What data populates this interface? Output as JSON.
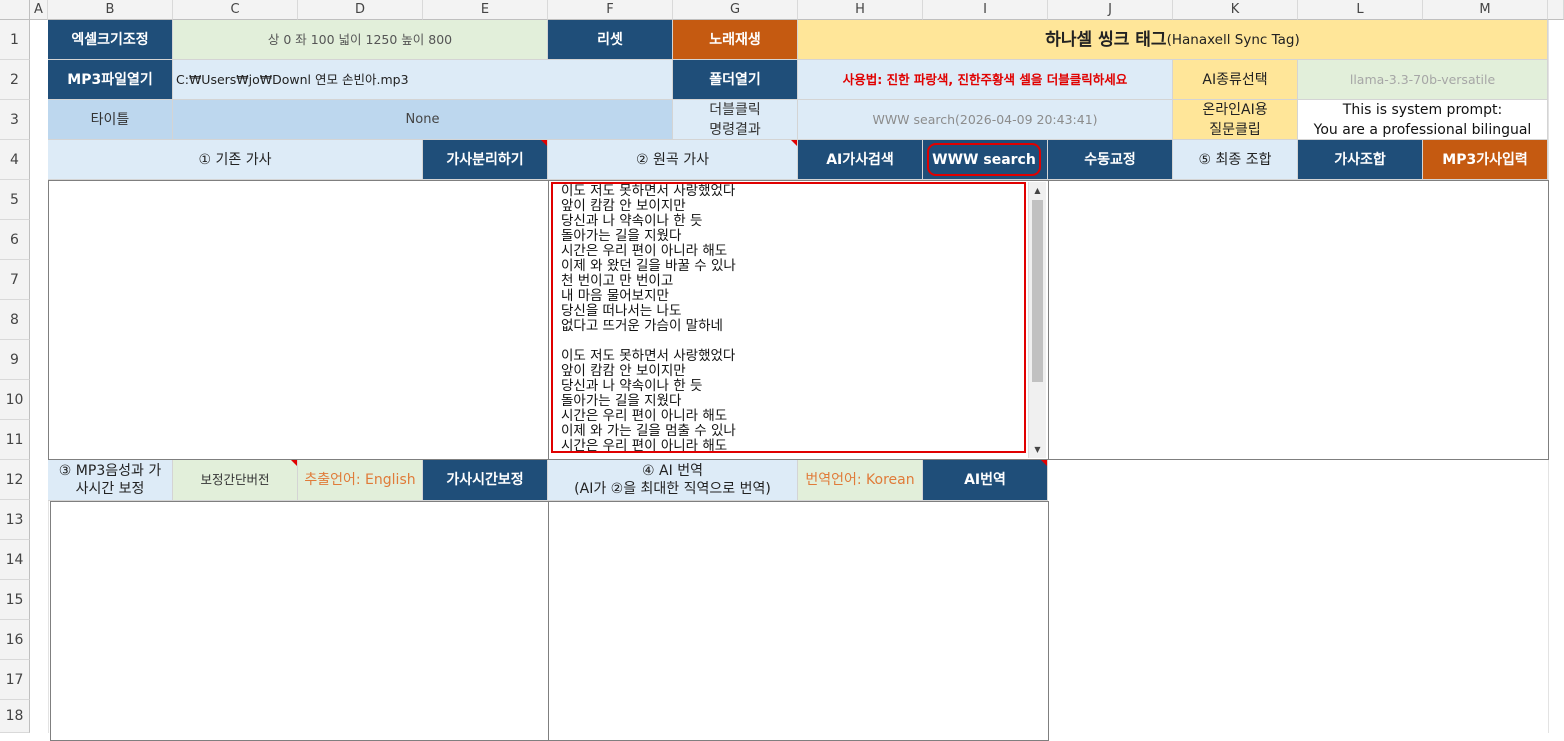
{
  "columns": [
    "A",
    "B",
    "C",
    "D",
    "E",
    "F",
    "G",
    "H",
    "I",
    "J",
    "K",
    "L",
    "M"
  ],
  "rows": [
    "1",
    "2",
    "3",
    "4",
    "5",
    "6",
    "7",
    "8",
    "9",
    "10",
    "11",
    "12",
    "13",
    "14",
    "15",
    "16",
    "17",
    "18"
  ],
  "row1": {
    "resize_button": "엑셀크기조정",
    "resize_values": "상 0 좌 100 넓이 1250 높이 800",
    "reset_button": "리셋",
    "play_button": "노래재생",
    "app_title": "하나셀 씽크 태그",
    "app_title_en": "(Hanaxell Sync Tag)"
  },
  "row2": {
    "open_mp3_button": "MP3파일열기",
    "file_path": "C:₩Users₩jo₩Downl 연모 손빈아.mp3",
    "open_folder_button": "폴더열기",
    "usage_hint": "사용법: 진한 파랑색, 진한주황색 셀을 더블클릭하세요",
    "ai_type_button": "AI종류선택",
    "ai_model": "llama-3.3-70b-versatile"
  },
  "row3": {
    "title_label": "타이틀",
    "title_value": "None",
    "dblclick_label_1": "더블클릭",
    "dblclick_label_2": "명령결과",
    "command_result": "WWW search(2026-04-09 20:43:41)",
    "online_ai_1": "온라인AI용",
    "online_ai_2": "질문클립",
    "system_prompt_1": "This is system prompt:",
    "system_prompt_2": "You are a professional bilingual"
  },
  "row4": {
    "existing_lyrics": "① 기존 가사",
    "split_lyrics_button": "가사분리하기",
    "original_lyrics": "② 원곡 가사",
    "ai_lyrics_search_button": "AI가사검색",
    "www_search_button": "WWW search",
    "manual_edit_button": "수동교정",
    "final_combine": "⑤ 최종 조합",
    "combine_lyrics_button": "가사조합",
    "mp3_lyrics_input_button": "MP3가사입력"
  },
  "lyrics": {
    "text": "이도 저도 못하면서 사랑했었다\n앞이 캄캄 안 보이지만\n당신과 나 약속이나 한 듯\n돌아가는 길을 지웠다\n시간은 우리 편이 아니라 해도\n이제 와 왔던 길을 바꿀 수 있나\n천 번이고 만 번이고\n내 마음 물어보지만\n당신을 떠나서는 나도\n없다고 뜨거운 가슴이 말하네\n\n이도 저도 못하면서 사랑했었다\n앞이 캄캄 안 보이지만\n당신과 나 약속이나 한 듯\n돌아가는 길을 지웠다\n시간은 우리 편이 아니라 해도\n이제 와 가는 길을 멈출 수 있나\n시간은 우리 편이 아니라 해도"
  },
  "row12": {
    "mp3_sync_1": "③ MP3음성과 가",
    "mp3_sync_2": "사시간 보정",
    "sync_version": "보정간단버전",
    "extract_lang": "추출언어: English",
    "lyrics_time_sync_button": "가사시간보정",
    "ai_translation_1": "④ AI 번역",
    "ai_translation_2": "(AI가 ②을 최대한 직역으로 번역)",
    "translate_lang": "번역언어: Korean",
    "ai_translate_button": "AI번역"
  },
  "colors": {
    "navy": "#1f4e79",
    "orange": "#c55a11",
    "highlight_red": "#e00000",
    "yellow": "#ffe699"
  }
}
